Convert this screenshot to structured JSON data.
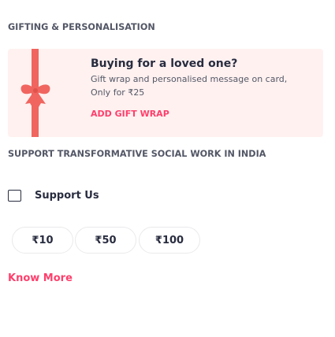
{
  "gifting": {
    "section_title": "GIFTING & PERSONALISATION",
    "heading": "Buying for a loved one?",
    "description": "Gift wrap and personalised message on card,",
    "price_text": "Only for ₹25",
    "cta_label": "ADD GIFT WRAP",
    "ribbon_icon": "gift-ribbon-icon",
    "card_bg": "#fff1f0",
    "ribbon_color": "#f0655f",
    "cta_color": "#ff3f6c"
  },
  "support": {
    "section_title": "SUPPORT TRANSFORMATIVE SOCIAL WORK IN INDIA",
    "checkbox_label": "Support Us",
    "checkbox_checked": false,
    "amounts": [
      "₹10",
      "₹50",
      "₹100"
    ],
    "know_more_label": "Know More",
    "accent_color": "#ff3f6c"
  }
}
